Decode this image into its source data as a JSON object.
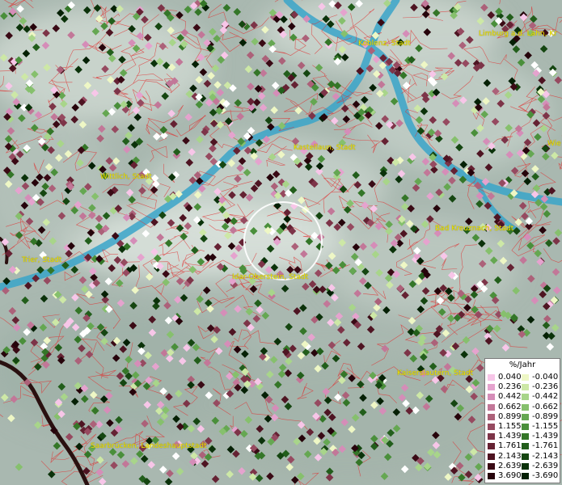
{
  "map": {
    "cities": [
      {
        "name": "Koblenz, Stadt",
        "anchor": "koblenz"
      },
      {
        "name": "Limburg a.d. Lahn, Kr",
        "anchor": "limburg"
      },
      {
        "name": "Kastellaun, Stadt",
        "anchor": "kastellaun"
      },
      {
        "name": "Wittlich, Stadt",
        "anchor": "wittlich"
      },
      {
        "name": "Wie",
        "anchor": "wie"
      },
      {
        "name": "Bad Kreuznach, Stadt",
        "anchor": "kreuznach"
      },
      {
        "name": "Trier, Stadt",
        "anchor": "trier"
      },
      {
        "name": "Idar-Oberstein, Stadt",
        "anchor": "idar"
      },
      {
        "name": "Kaiserslautern, Stadt",
        "anchor": "kaiserslautern"
      },
      {
        "name": "Saarbrücken, Landeshauptstadt",
        "anchor": "saarbruecken"
      }
    ],
    "colors": {
      "terrain": "#a9b8b0",
      "river": "#3aa5c9",
      "boundary": "#e03030",
      "label": "#f2e600",
      "border_line": "#2a1010"
    }
  },
  "legend": {
    "title": "%/Jahr",
    "positive": [
      {
        "value": "0.040",
        "color": "#f7c6e8"
      },
      {
        "value": "0.236",
        "color": "#e5a3ce"
      },
      {
        "value": "0.442",
        "color": "#d58db8"
      },
      {
        "value": "0.662",
        "color": "#c27798"
      },
      {
        "value": "0.899",
        "color": "#ac6179"
      },
      {
        "value": "1.155",
        "color": "#964a60"
      },
      {
        "value": "1.439",
        "color": "#7d3448"
      },
      {
        "value": "1.761",
        "color": "#652233"
      },
      {
        "value": "2.143",
        "color": "#4e1422"
      },
      {
        "value": "2.639",
        "color": "#3a0a15"
      },
      {
        "value": "3.690",
        "color": "#26040b"
      }
    ],
    "negative": [
      {
        "value": "-0.040",
        "color": "#eef7c5"
      },
      {
        "value": "-0.236",
        "color": "#cde8a6"
      },
      {
        "value": "-0.442",
        "color": "#a8d58a"
      },
      {
        "value": "-0.662",
        "color": "#86c06d"
      },
      {
        "value": "-0.899",
        "color": "#65a752"
      },
      {
        "value": "-1.155",
        "color": "#4a8f3b"
      },
      {
        "value": "-1.439",
        "color": "#347628"
      },
      {
        "value": "-1.761",
        "color": "#225e1b"
      },
      {
        "value": "-2.143",
        "color": "#154611"
      },
      {
        "value": "-2.639",
        "color": "#0b320a"
      },
      {
        "value": "-3.690",
        "color": "#052005"
      }
    ]
  }
}
